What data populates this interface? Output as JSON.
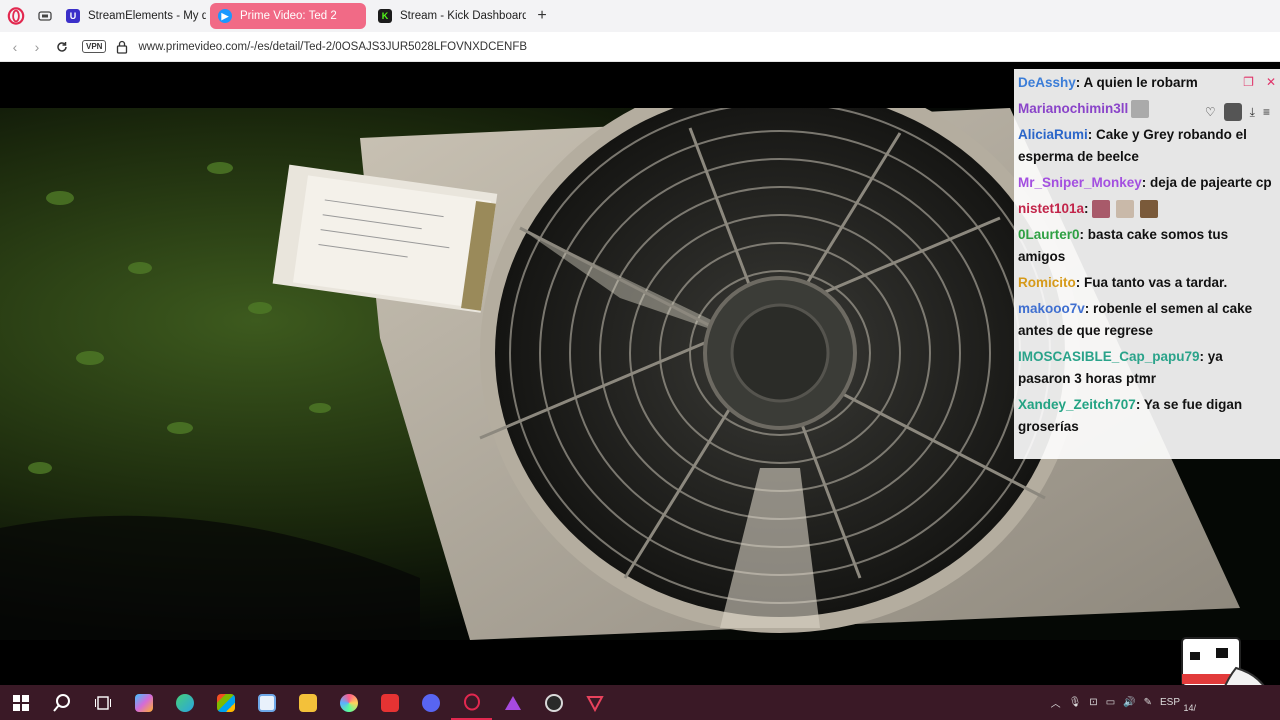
{
  "browser": {
    "tabs": [
      {
        "label": "StreamElements - My das",
        "favicon_color": "#3b2fc9"
      },
      {
        "label": "Prime Video: Ted 2",
        "favicon_color": "#1a98ff",
        "close": "×"
      },
      {
        "label": "Stream - Kick Dashboard",
        "favicon_color": "#53fc18"
      }
    ],
    "new_tab_label": "+",
    "vpn_label": "VPN",
    "url": "www.primevideo.com/-/es/detail/Ted-2/0OSAJS3JUR5028LFOVNXDCENFB",
    "accent": "#f16a86"
  },
  "chat": {
    "messages": [
      {
        "user": "DeAsshy",
        "color": "#3b7dd8",
        "text": ": A quien le robarm"
      },
      {
        "user": "Marianochimin3ll",
        "color": "#8a44c9",
        "text": ""
      },
      {
        "user": "AliciaRumi",
        "color": "#2b66c9",
        "text": ": Cake y Grey robando el esperma de beelce"
      },
      {
        "user": "Mr_Sniper_Monkey",
        "color": "#a34fe0",
        "text": ": deja de pajearte cp"
      },
      {
        "user": "nistet101a",
        "color": "#c2254a",
        "text": ":"
      },
      {
        "user": "0Laurter0",
        "color": "#2ea043",
        "text": ": basta cake somos tus amigos"
      },
      {
        "user": "Romicito",
        "color": "#d69a1a",
        "text": ": Fua tanto vas a tardar."
      },
      {
        "user": "makooo7v",
        "color": "#3f6fd0",
        "text": ": robenle el semen al cake antes de que regrese"
      },
      {
        "user": "IMOSCASIBLE_Cap_papu79",
        "color": "#2aa38a",
        "text": ": ya pasaron 3 horas ptmr"
      },
      {
        "user": "Xandey_Zeitch707",
        "color": "#22a383",
        "text": ": Ya se fue digan groserías"
      }
    ]
  },
  "taskbar": {
    "icons": [
      {
        "name": "windows-start-icon",
        "color": "#ffffff"
      },
      {
        "name": "search-icon",
        "color": "#ffffff"
      },
      {
        "name": "task-view-icon",
        "color": "#ffffff"
      },
      {
        "name": "copilot-icon",
        "color": "#d46bd8"
      },
      {
        "name": "edge-icon",
        "color": "#2aa4e0"
      },
      {
        "name": "store-icon",
        "color": "#1f7fd6"
      },
      {
        "name": "notepad-icon",
        "color": "#6ea8e8"
      },
      {
        "name": "file-explorer-icon",
        "color": "#f3c13a"
      },
      {
        "name": "app-colorful-icon",
        "color": "#e4a1e6"
      },
      {
        "name": "wps-icon",
        "color": "#e63333"
      },
      {
        "name": "discord-icon",
        "color": "#5865f2"
      },
      {
        "name": "opera-gx-icon",
        "color": "#e2284f"
      },
      {
        "name": "affinity-icon",
        "color": "#a74ae0"
      },
      {
        "name": "obs-icon",
        "color": "#d9d9d9"
      },
      {
        "name": "vivaldi-icon",
        "color": "#e8425c"
      }
    ],
    "language": "ESP",
    "clock": "14/"
  }
}
